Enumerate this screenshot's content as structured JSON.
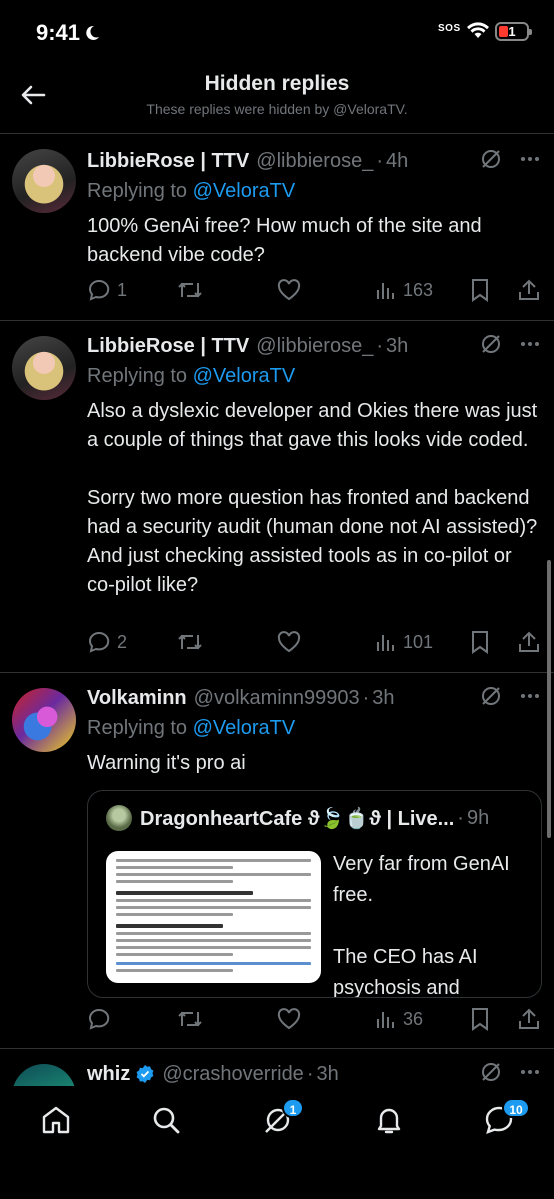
{
  "status_bar": {
    "time": "9:41",
    "sos": "SOS",
    "battery": "1"
  },
  "header": {
    "title": "Hidden replies",
    "subtitle": "These replies were hidden by @VeloraTV."
  },
  "tweets": [
    {
      "name": "LibbieRose | TTV",
      "handle": "@libbierose_",
      "time": "4h",
      "replying_prefix": "Replying to ",
      "replying_to": "@VeloraTV",
      "text": "100% GenAi free? How much of the site and backend vibe code?",
      "replies": "1",
      "retweets": "",
      "likes": "",
      "views": "163"
    },
    {
      "name": "LibbieRose | TTV",
      "handle": "@libbierose_",
      "time": "3h",
      "replying_prefix": "Replying to ",
      "replying_to": "@VeloraTV",
      "text": "Also a dyslexic developer and Okies there was just a couple of things that gave this looks vide coded.\n\nSorry two more question has fronted and backend had a security audit (human done not AI assisted)? And just checking assisted tools as in co-pilot or co-pilot like?",
      "replies": "2",
      "retweets": "",
      "likes": "",
      "views": "101"
    },
    {
      "name": "Volkaminn",
      "handle": "@volkaminn99903",
      "time": "3h",
      "replying_prefix": "Replying to ",
      "replying_to": "@VeloraTV",
      "text": "Warning it's pro ai",
      "quote": {
        "name": "DragonheartCafe ϑ🍃🍵ϑ | Live...",
        "time": "9h",
        "text": "Very far from GenAI free.\n\nThe CEO has AI psychosis and compared calling his A..."
      },
      "replies": "",
      "retweets": "",
      "likes": "",
      "views": "36"
    },
    {
      "name": "whiz",
      "handle": "@crashoverride",
      "time": "3h"
    }
  ],
  "tabbar": {
    "grok_badge": "1",
    "messages_badge": "10"
  },
  "icons": [
    "back-arrow-icon",
    "hide-reply-icon",
    "more-icon",
    "reply-icon",
    "retweet-icon",
    "like-icon",
    "views-icon",
    "bookmark-icon",
    "share-icon",
    "verified-badge-icon",
    "home-icon",
    "search-icon",
    "grok-icon",
    "bell-icon",
    "messages-icon"
  ]
}
